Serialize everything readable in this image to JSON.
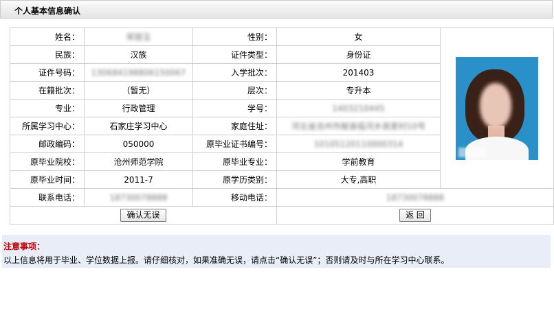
{
  "page": {
    "title": "个人基本信息确认"
  },
  "labels": {
    "name": "姓名：",
    "gender": "性别：",
    "ethnicity": "民族：",
    "id_type": "证件类型：",
    "id_number": "证件号码：",
    "admission_batch": "入学批次：",
    "current_batch": "在籍批次：",
    "level": "层次：",
    "major": "专业：",
    "student_no": "学号：",
    "center": "所属学习中心：",
    "address": "家庭住址：",
    "postcode": "邮政编码：",
    "prev_cert_no": "原毕业证书编号：",
    "prev_school": "原毕业院校：",
    "prev_major": "原毕业专业：",
    "grad_time": "原毕业时间：",
    "prev_edu_type": "原学历类别：",
    "phone": "联系电话：",
    "mobile": "移动电话："
  },
  "values": {
    "name": "宋丽玉",
    "gender": "女",
    "ethnicity": "汉族",
    "id_type": "身份证",
    "id_number": "130684198806150067",
    "admission_batch": "201403",
    "current_batch": "（暂无）",
    "level": "专升本",
    "major": "行政管理",
    "student_no": "1403210445",
    "center": "石家庄学习中心",
    "address": "河北省沧州市献县临河乡高家村10号",
    "postcode": "050000",
    "prev_cert_no": "10105120110000314",
    "prev_school": "沧州师范学院",
    "prev_major": "学前教育",
    "grad_time": "2011-7",
    "prev_edu_type": "大专,高职",
    "phone": "18730078888",
    "mobile": "18730078888"
  },
  "buttons": {
    "confirm": "确认无误",
    "back": "返 回"
  },
  "notice": {
    "heading": "注意事项：",
    "text": "以上信息将用于毕业、学位数据上报。请仔细核对，如果准确无误，请点击“确认无误”；否则请及时与所在学习中心联系。"
  }
}
